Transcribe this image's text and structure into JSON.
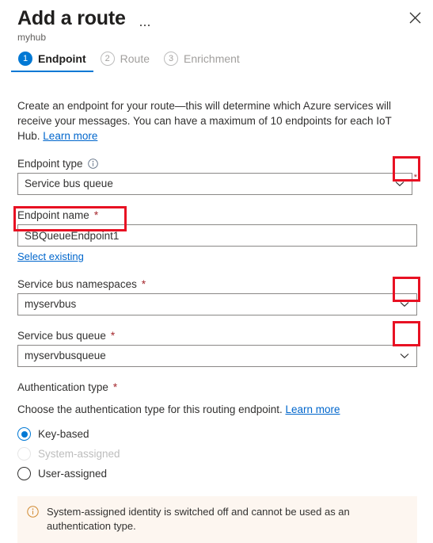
{
  "header": {
    "title": "Add a route",
    "subtitle": "myhub",
    "more_label": "More options",
    "close_label": "Close"
  },
  "tabs": [
    {
      "num": "1",
      "label": "Endpoint",
      "state": "active"
    },
    {
      "num": "2",
      "label": "Route",
      "state": "inactive"
    },
    {
      "num": "3",
      "label": "Enrichment",
      "state": "inactive"
    }
  ],
  "intro": {
    "text": "Create an endpoint for your route—this will determine which Azure services will receive your messages. You can have a maximum of 10 endpoints for each IoT Hub.",
    "link": "Learn more"
  },
  "endpoint_type": {
    "label": "Endpoint type",
    "value": "Service bus queue",
    "required_marker": "*"
  },
  "endpoint_name": {
    "label": "Endpoint name",
    "required_marker": "*",
    "value": "SBQueueEndpoint1",
    "placeholder": "",
    "sublink": "Select existing"
  },
  "namespace": {
    "label": "Service bus namespaces",
    "required_marker": "*",
    "value": "myservbus"
  },
  "queue": {
    "label": "Service bus queue",
    "required_marker": "*",
    "value": "myservbusqueue"
  },
  "auth": {
    "label": "Authentication type",
    "required_marker": "*",
    "helper_text": "Choose the authentication type for this routing endpoint.",
    "helper_link": "Learn more",
    "options": [
      {
        "label": "Key-based",
        "selected": true,
        "disabled": false
      },
      {
        "label": "System-assigned",
        "selected": false,
        "disabled": true
      },
      {
        "label": "User-assigned",
        "selected": false,
        "disabled": false
      }
    ]
  },
  "banner": {
    "icon": "info-circle-icon",
    "text": "System-assigned identity is switched off and cannot be used as an authentication type."
  },
  "colors": {
    "accent": "#0078d4",
    "link": "#0066cc",
    "required": "#a4262c",
    "annotation": "#e81123",
    "banner_bg": "#fdf6f0",
    "banner_icon": "#d18b33"
  }
}
